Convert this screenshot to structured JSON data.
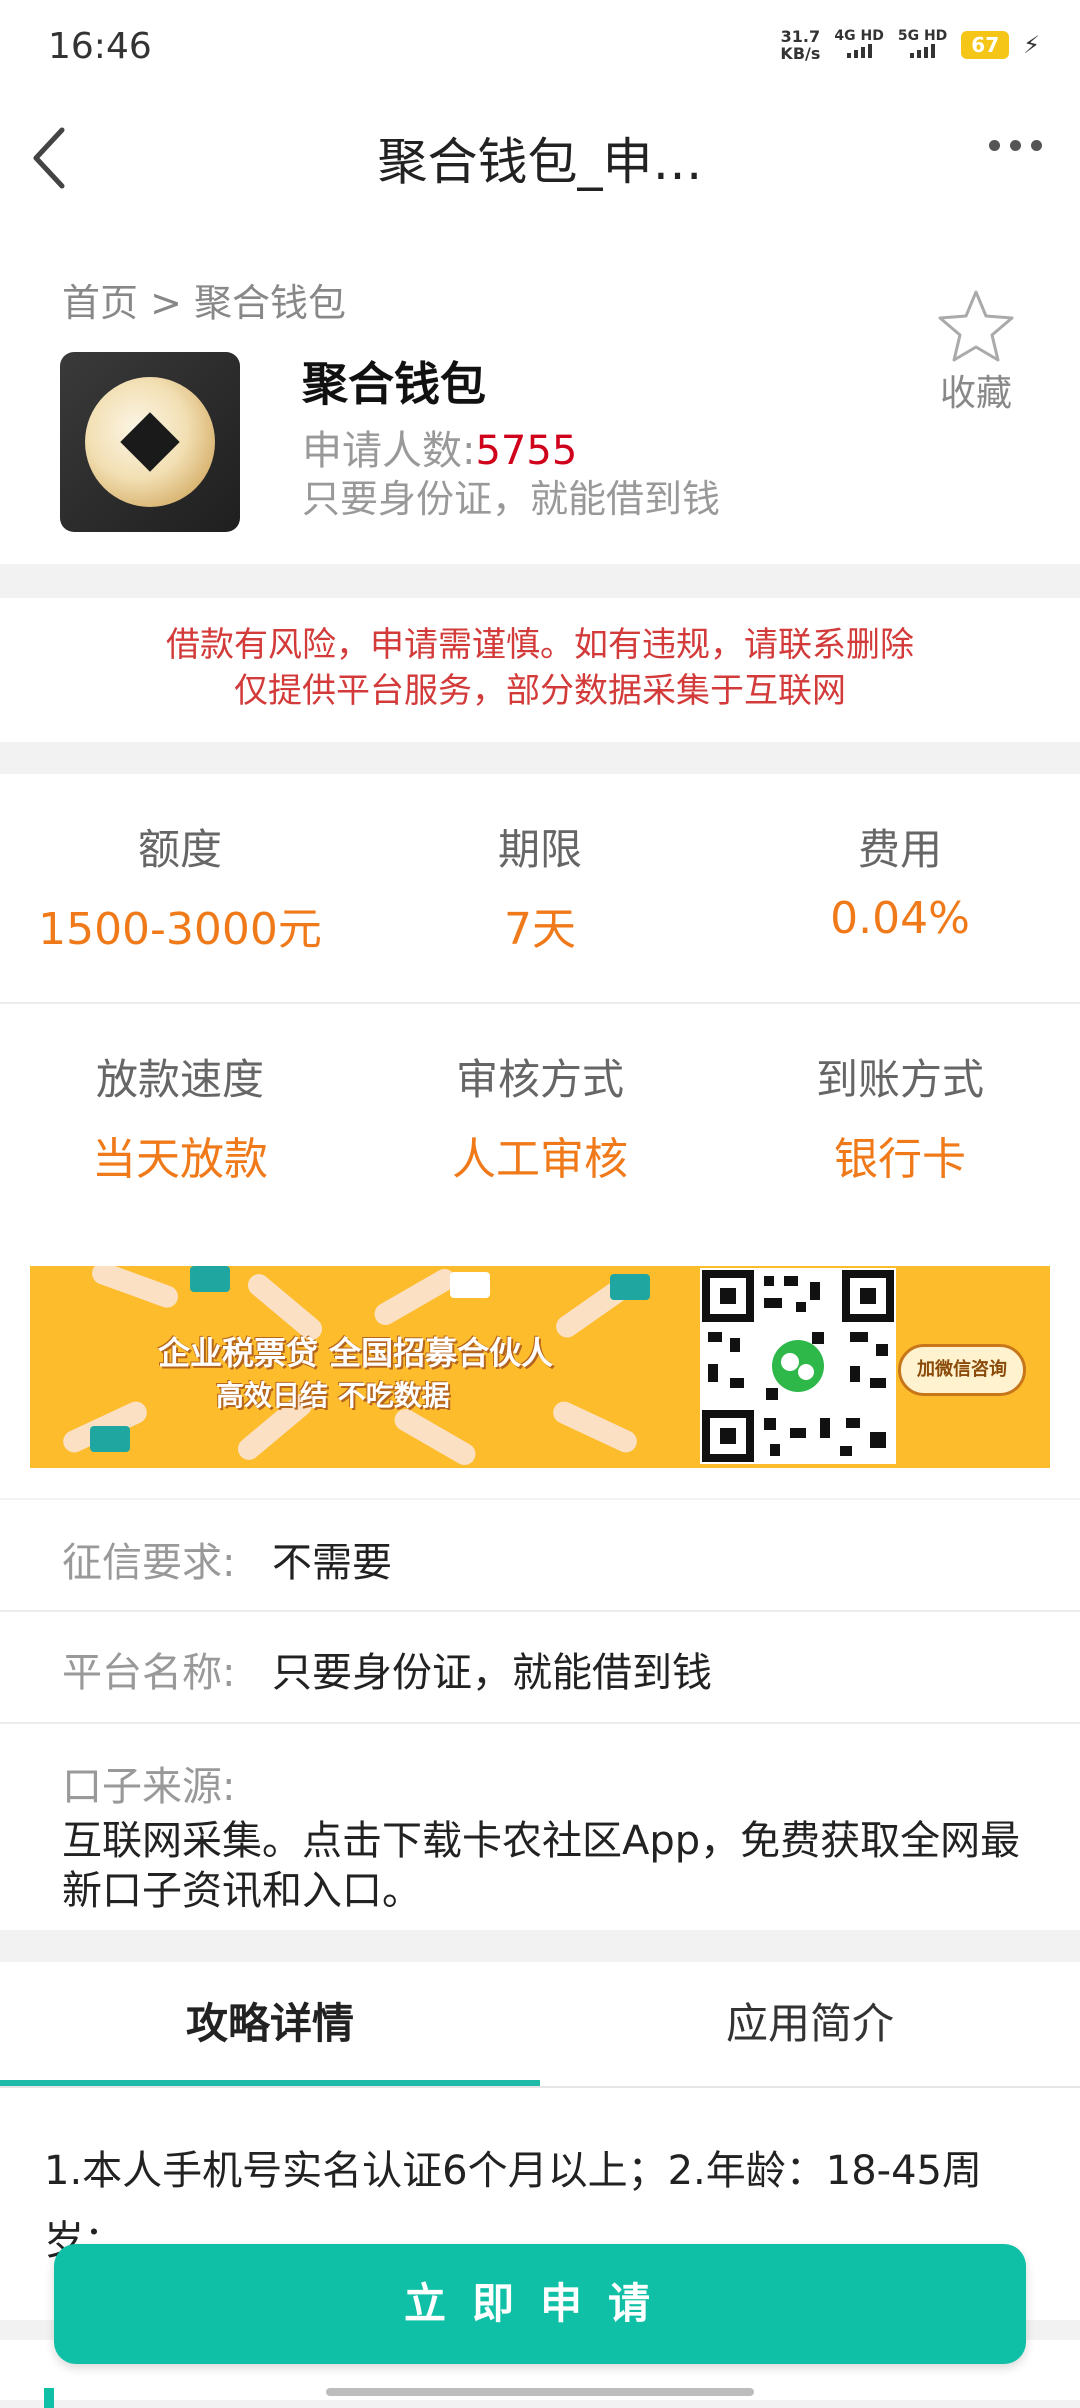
{
  "status_bar": {
    "time": "16:46",
    "speed_value": "31.7",
    "speed_unit": "KB/s",
    "sim1": "4G HD",
    "sim2": "5G HD",
    "battery": "67"
  },
  "nav": {
    "title": "聚合钱包_申…"
  },
  "header": {
    "breadcrumb": "首页 > 聚合钱包",
    "app_name": "聚合钱包",
    "applicants_label": "申请人数:",
    "applicants_count": "5755",
    "tagline": "只要身份证，就能借到钱",
    "favorite_label": "收藏"
  },
  "notice": {
    "line1": "借款有风险，申请需谨慎。如有违规，请联系删除",
    "line2": "仅提供平台服务，部分数据采集于互联网"
  },
  "stats": [
    {
      "label": "额度",
      "value": "1500-3000元"
    },
    {
      "label": "期限",
      "value": "7天"
    },
    {
      "label": "费用",
      "value": "0.04%"
    },
    {
      "label": "放款速度",
      "value": "当天放款"
    },
    {
      "label": "审核方式",
      "value": "人工审核"
    },
    {
      "label": "到账方式",
      "value": "银行卡"
    }
  ],
  "banner": {
    "line1": "企业税票贷  全国招募合伙人",
    "line2": "高效日结  不吃数据",
    "button": "加微信咨询"
  },
  "info": {
    "credit_label": "征信要求:",
    "credit_value": "不需要",
    "platform_label": "平台名称:",
    "platform_value": "只要身份证，就能借到钱",
    "source_label": "口子来源:",
    "source_value": "互联网采集。点击下载卡农社区App，免费获取全网最新口子资讯和入口。"
  },
  "tabs": [
    {
      "label": "攻略详情"
    },
    {
      "label": "应用简介"
    }
  ],
  "content": {
    "text": "1.本人手机号实名认证6个月以上；2.年龄：18-45周岁；"
  },
  "apply_button": "立即申请",
  "colors": {
    "accent": "#0fc0a6",
    "value_orange": "#f07a1a",
    "notice_red": "#d33a3a",
    "count_red": "#d0021b"
  }
}
